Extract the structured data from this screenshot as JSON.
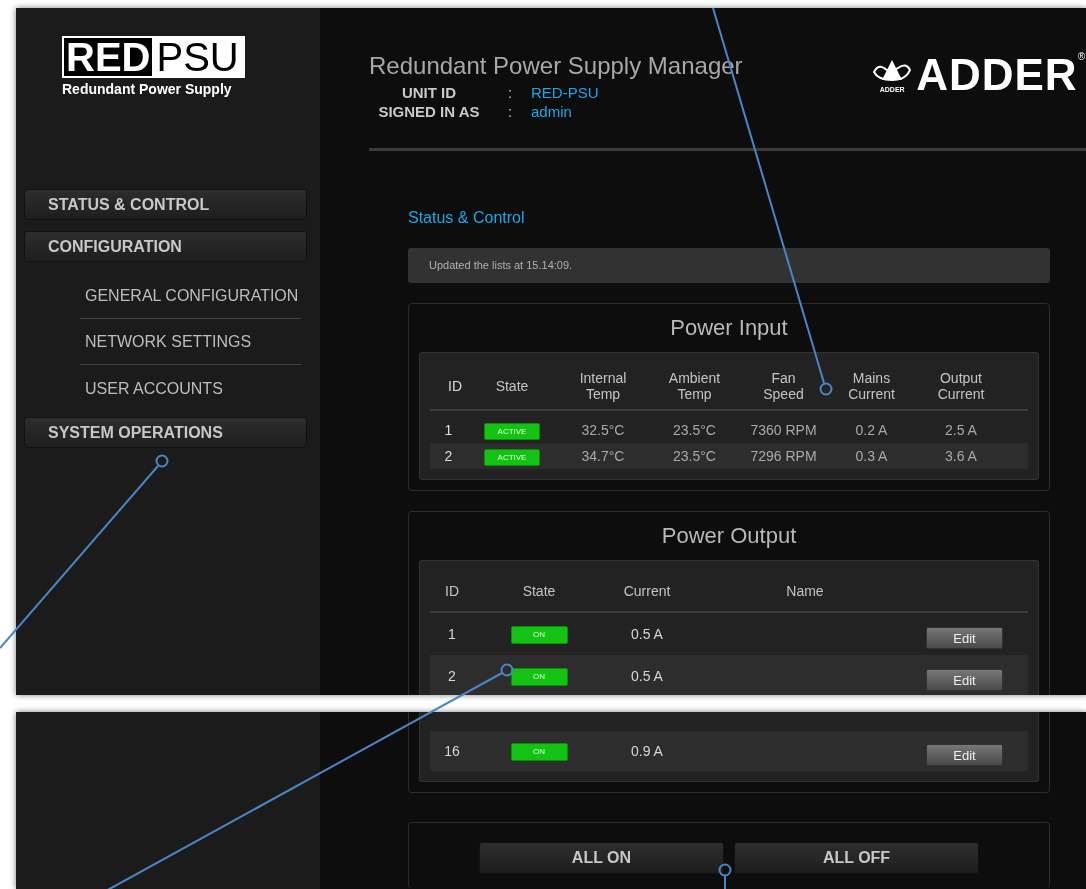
{
  "logo": {
    "boxed": "RED",
    "plain": "PSU",
    "tagline": "Redundant Power Supply"
  },
  "nav": [
    {
      "label": "STATUS & CONTROL"
    },
    {
      "label": "CONFIGURATION",
      "children": [
        {
          "label": "GENERAL CONFIGURATION"
        },
        {
          "label": "NETWORK SETTINGS"
        },
        {
          "label": "USER ACCOUNTS"
        }
      ]
    },
    {
      "label": "SYSTEM OPERATIONS"
    }
  ],
  "header": {
    "title": "Redundant Power Supply Manager",
    "fields": [
      {
        "label": "UNIT ID",
        "separator": ":",
        "value": "RED-PSU"
      },
      {
        "label": "SIGNED IN AS",
        "separator": ":",
        "value": "admin"
      }
    ],
    "brand": {
      "emblem_text": "ADDER",
      "wordmark": "ADDER$^{®}$"
    }
  },
  "page_title": "Status & Control",
  "update_message": "Updated the lists at 15.14:09.",
  "power_input": {
    "title": "Power Input",
    "columns": [
      "ID",
      "State",
      "Internal Temp",
      "Ambient Temp",
      "Fan Speed",
      "Mains Current",
      "Output Current"
    ],
    "rows": [
      {
        "id": "1",
        "state": "ACTIVE",
        "active": true,
        "internal_temp": "32.5°C",
        "ambient_temp": "23.5°C",
        "fan_speed": "7360 RPM",
        "mains_current": "0.2 A",
        "output_current": "2.5 A"
      },
      {
        "id": "2",
        "state": "ACTIVE",
        "active": true,
        "internal_temp": "34.7°C",
        "ambient_temp": "23.5°C",
        "fan_speed": "7296 RPM",
        "mains_current": "0.3 A",
        "output_current": "3.6 A"
      }
    ]
  },
  "power_output": {
    "title": "Power Output",
    "columns": [
      "ID",
      "State",
      "Current",
      "Name"
    ],
    "rows_before_break": [
      {
        "id": "1",
        "state": "ON",
        "on": true,
        "current": "0.5 A",
        "action": "Edit"
      },
      {
        "id": "2",
        "state": "ON",
        "on": true,
        "current": "0.5 A",
        "action": "Edit"
      }
    ],
    "rows_after_break": [
      {
        "id": "16",
        "state": "ON",
        "on": true,
        "current": "0.9 A",
        "action": "Edit"
      }
    ]
  },
  "buttons": [
    "ALL ON",
    "ALL OFF"
  ]
}
